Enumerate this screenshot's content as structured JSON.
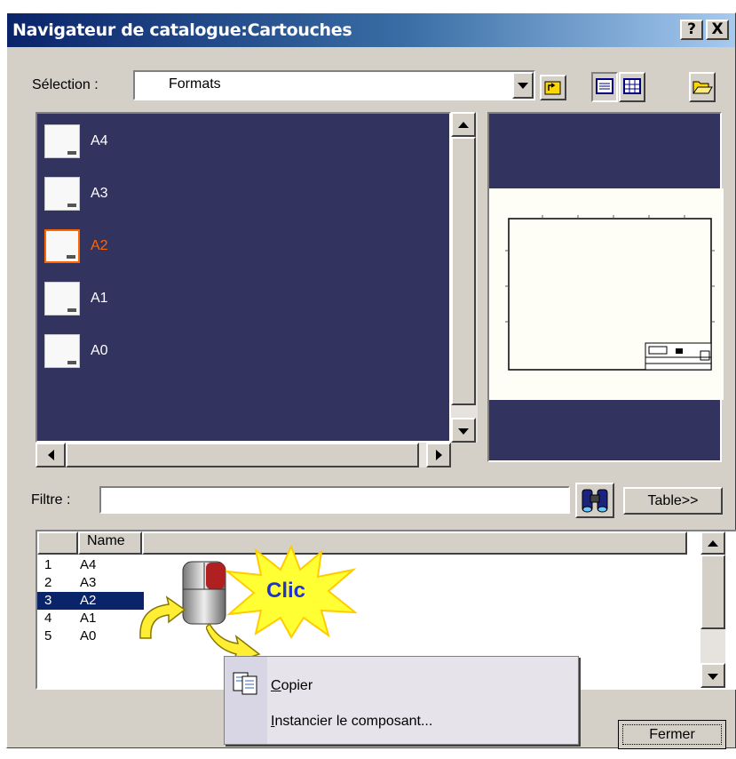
{
  "window": {
    "title": "Navigateur de catalogue:Cartouches",
    "help_label": "?",
    "close_label": "X"
  },
  "selection": {
    "label": "Sélection :",
    "value": "Formats"
  },
  "toolbar": {
    "icons": [
      "parent-folder-icon",
      "detail-view-icon",
      "grid-view-icon",
      "open-catalog-icon"
    ]
  },
  "catalog": {
    "items": [
      {
        "label": "A4",
        "selected": false
      },
      {
        "label": "A3",
        "selected": false
      },
      {
        "label": "A2",
        "selected": true
      },
      {
        "label": "A1",
        "selected": false
      },
      {
        "label": "A0",
        "selected": false
      }
    ],
    "background": "#33335f",
    "selected_color": "#ff6600"
  },
  "filter": {
    "label": "Filtre :",
    "value": "",
    "table_button": "Table>>"
  },
  "grid": {
    "header": "Name",
    "rows": [
      {
        "num": "1",
        "name": "A4",
        "selected": false
      },
      {
        "num": "2",
        "name": "A3",
        "selected": false
      },
      {
        "num": "3",
        "name": "A2",
        "selected": true
      },
      {
        "num": "4",
        "name": "A1",
        "selected": false
      },
      {
        "num": "5",
        "name": "A0",
        "selected": false
      }
    ]
  },
  "annotation": {
    "burst_text": "Clic",
    "burst_color": "#ffff33",
    "text_color": "#2233cc"
  },
  "context_menu": {
    "items": [
      {
        "label": "Copier",
        "icon": "copy-icon"
      },
      {
        "label": "Instancier le composant...",
        "icon": ""
      }
    ]
  },
  "buttons": {
    "close": "Fermer"
  }
}
